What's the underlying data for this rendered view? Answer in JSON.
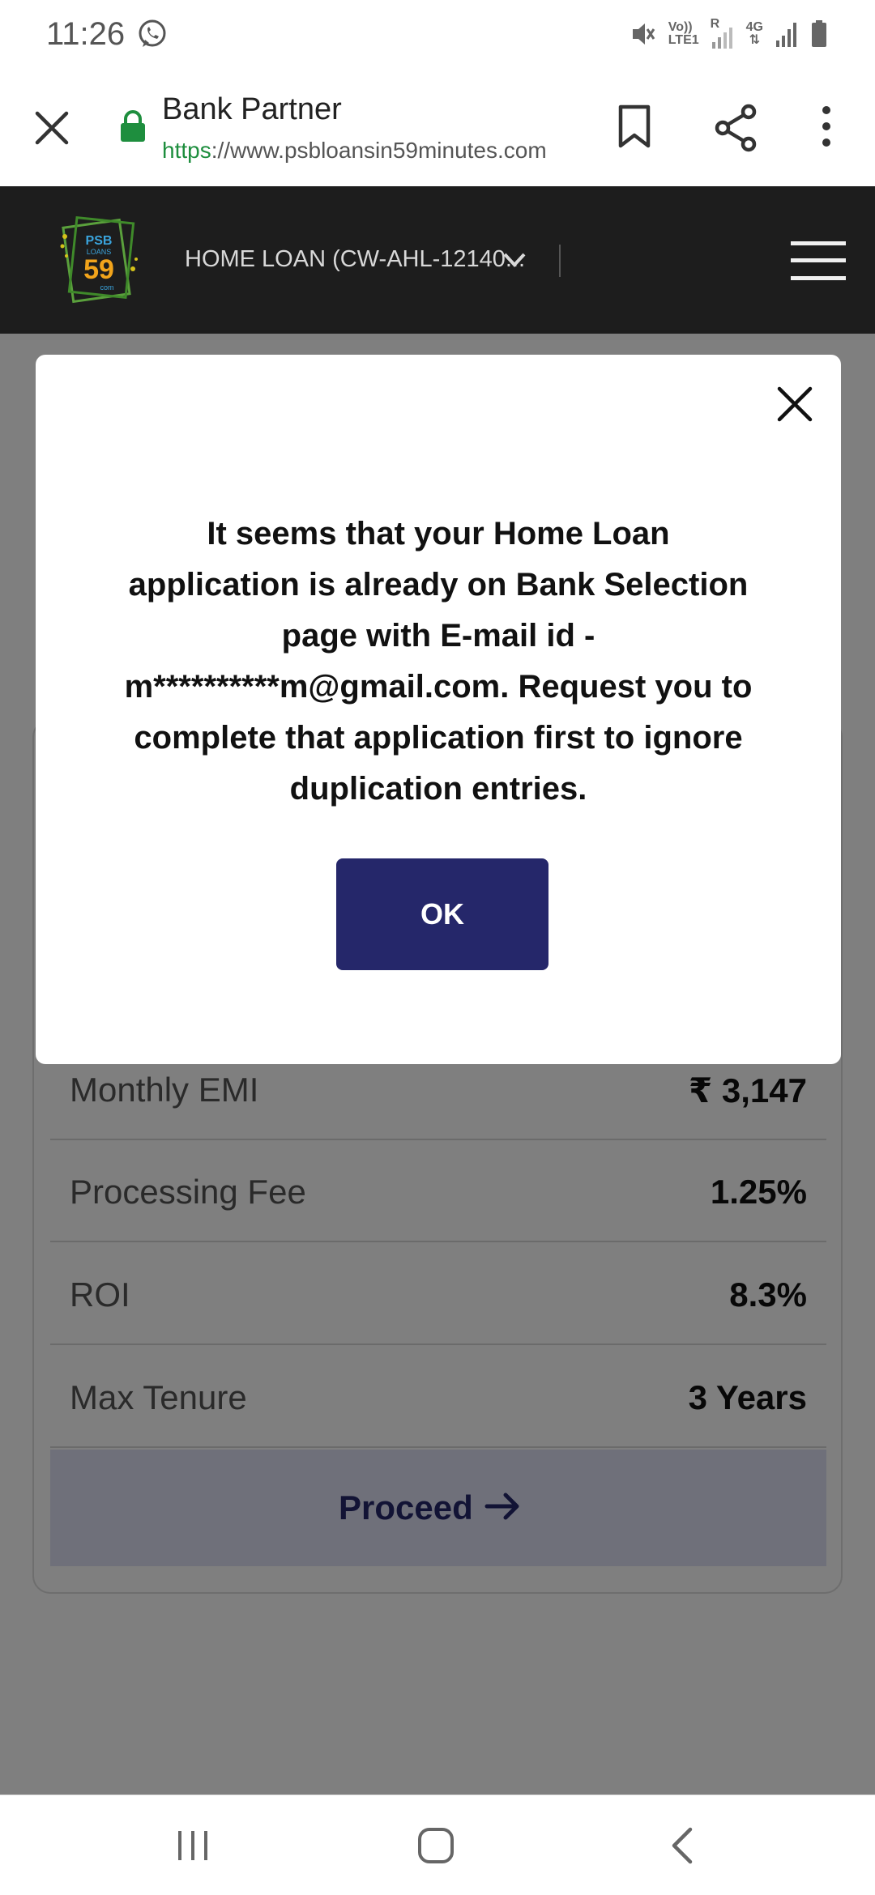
{
  "status_bar": {
    "time": "11:26",
    "network_labels": [
      "Vo))",
      "LTE1",
      "R",
      "4G"
    ]
  },
  "browser": {
    "site_title": "Bank Partner",
    "url_scheme": "https",
    "url_rest": "://www.psbloansin59minutes.com"
  },
  "header": {
    "logo_text_top": "PSB",
    "logo_text_mid": "LOANS",
    "logo_number": "59",
    "logo_text_bottom": "com",
    "loan_select_text": "HOME LOAN (CW-AHL-12140..."
  },
  "offer": {
    "rows": [
      {
        "label": "Monthly EMI",
        "value": "₹ 3,147"
      },
      {
        "label": "Processing Fee",
        "value": "1.25%"
      },
      {
        "label": "ROI",
        "value": "8.3%"
      },
      {
        "label": "Max Tenure",
        "value": "3 Years"
      }
    ],
    "proceed_label": "Proceed"
  },
  "modal": {
    "message": "It seems that your Home Loan application is already on Bank Selection page with E-mail id - m**********m@gmail.com. Request you to complete that application first to ignore duplication entries.",
    "ok_label": "OK"
  },
  "colors": {
    "brand_primary": "#25276a",
    "header_bg": "#1d1d1d",
    "secure_green": "#1e8e3e"
  }
}
